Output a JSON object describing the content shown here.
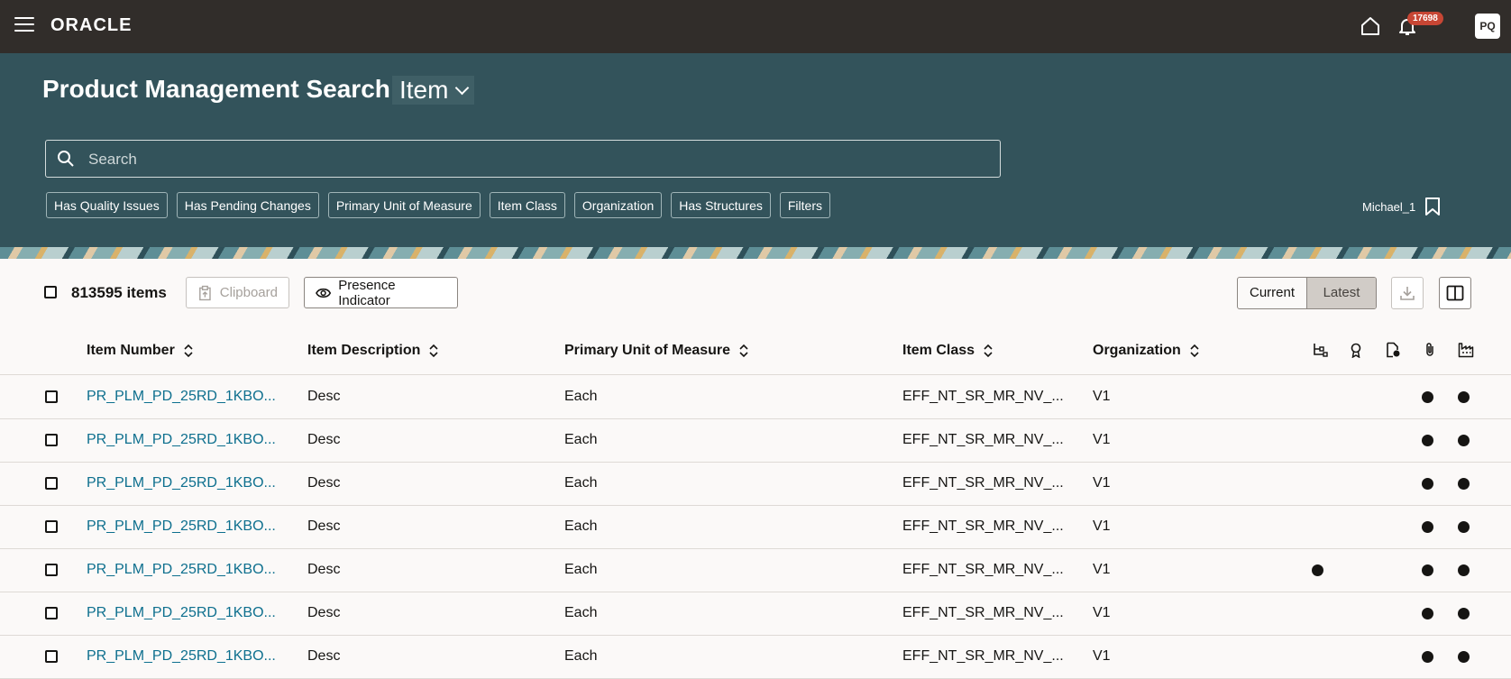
{
  "app": {
    "logo": "ORACLE",
    "notifications_count": "17698",
    "avatar_initials": "PQ"
  },
  "hero": {
    "title": "Product Management Search",
    "object_type": "Item",
    "search_placeholder": "Search",
    "filters": [
      "Has Quality Issues",
      "Has Pending Changes",
      "Primary Unit of Measure",
      "Item Class",
      "Organization",
      "Has Structures",
      "Filters"
    ],
    "saved_search": "Michael_1"
  },
  "toolbar": {
    "items_count": "813595 items",
    "clipboard_label": "Clipboard",
    "presence_label": "Presence Indicator",
    "version_options": [
      "Current",
      "Latest"
    ],
    "selected_version": "Latest"
  },
  "table": {
    "columns": [
      "Item Number",
      "Item Description",
      "Primary Unit of Measure",
      "Item Class",
      "Organization"
    ],
    "indicator_columns": [
      "structure-icon",
      "quality-icon",
      "pending-change-icon",
      "attachment-icon",
      "manufacturer-icon"
    ],
    "rows": [
      {
        "item_number": "PR_PLM_PD_25RD_1KBO...",
        "description": "Desc",
        "uom": "Each",
        "item_class": "EFF_NT_SR_MR_NV_...",
        "organization": "V1",
        "indicators": [
          false,
          false,
          false,
          true,
          true
        ]
      },
      {
        "item_number": "PR_PLM_PD_25RD_1KBO...",
        "description": "Desc",
        "uom": "Each",
        "item_class": "EFF_NT_SR_MR_NV_...",
        "organization": "V1",
        "indicators": [
          false,
          false,
          false,
          true,
          true
        ]
      },
      {
        "item_number": "PR_PLM_PD_25RD_1KBO...",
        "description": "Desc",
        "uom": "Each",
        "item_class": "EFF_NT_SR_MR_NV_...",
        "organization": "V1",
        "indicators": [
          false,
          false,
          false,
          true,
          true
        ]
      },
      {
        "item_number": "PR_PLM_PD_25RD_1KBO...",
        "description": "Desc",
        "uom": "Each",
        "item_class": "EFF_NT_SR_MR_NV_...",
        "organization": "V1",
        "indicators": [
          false,
          false,
          false,
          true,
          true
        ]
      },
      {
        "item_number": "PR_PLM_PD_25RD_1KBO...",
        "description": "Desc",
        "uom": "Each",
        "item_class": "EFF_NT_SR_MR_NV_...",
        "organization": "V1",
        "indicators": [
          true,
          false,
          false,
          true,
          true
        ]
      },
      {
        "item_number": "PR_PLM_PD_25RD_1KBO...",
        "description": "Desc",
        "uom": "Each",
        "item_class": "EFF_NT_SR_MR_NV_...",
        "organization": "V1",
        "indicators": [
          false,
          false,
          false,
          true,
          true
        ]
      },
      {
        "item_number": "PR_PLM_PD_25RD_1KBO...",
        "description": "Desc",
        "uom": "Each",
        "item_class": "EFF_NT_SR_MR_NV_...",
        "organization": "V1",
        "indicators": [
          false,
          false,
          false,
          true,
          true
        ]
      }
    ]
  },
  "colors": {
    "topbar": "#312d2a",
    "hero": "#33535b",
    "link": "#0d6f8e",
    "badge": "#c74634"
  }
}
